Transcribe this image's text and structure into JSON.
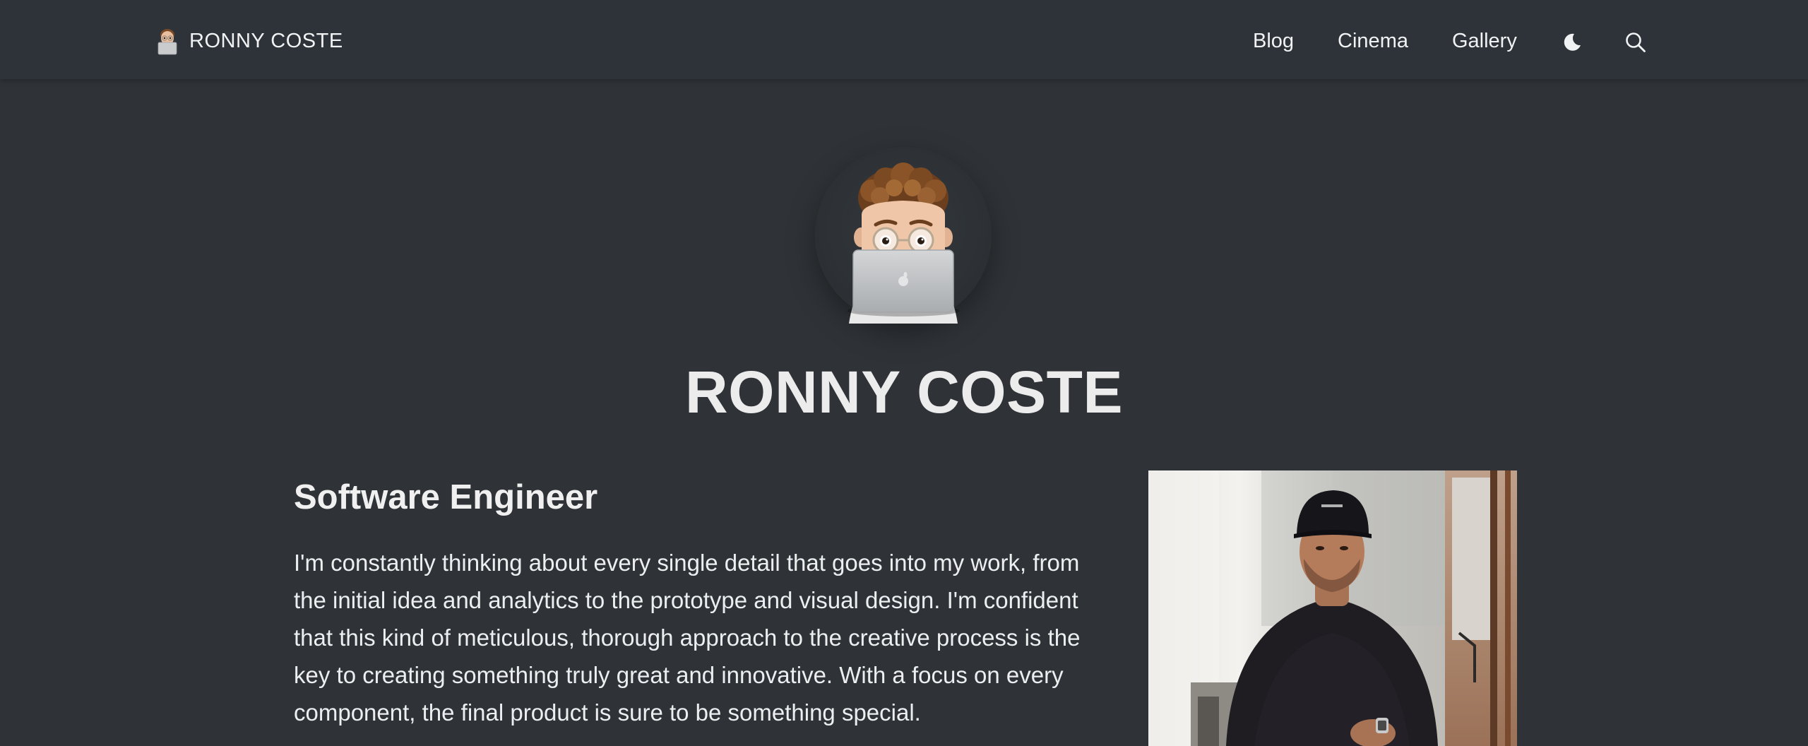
{
  "navbar": {
    "brand_text": "RONNY COSTE",
    "brand_icon": "memoji-laptop-icon",
    "links": [
      "Blog",
      "Cinema",
      "Gallery"
    ],
    "theme_toggle_icon": "moon-icon",
    "search_icon": "search-icon"
  },
  "hero": {
    "avatar_icon": "memoji-with-laptop",
    "title": "RONNY COSTE"
  },
  "about": {
    "role": "Software Engineer",
    "bio": "I'm constantly thinking about every single detail that goes into my work, from the initial idea and analytics to the prototype and visual design. I'm confident that this kind of meticulous, thorough approach to the creative process is the key to creating something truly great and innovative. With a focus on every component, the final product is sure to be something special."
  },
  "colors": {
    "background": "#2f3337",
    "navbar": "#2d3338",
    "text": "#eceeef"
  }
}
